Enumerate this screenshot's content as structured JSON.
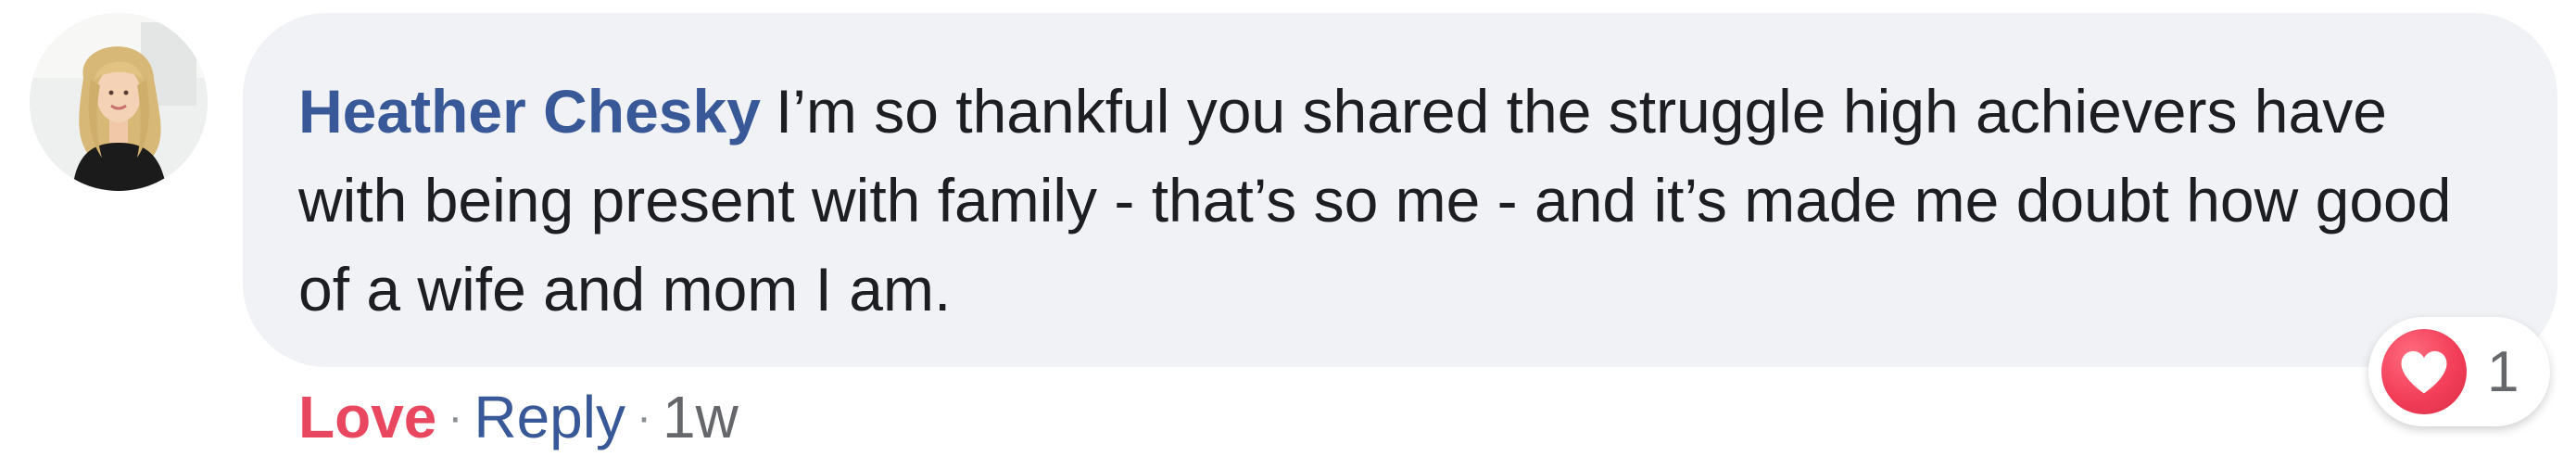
{
  "comment": {
    "author": "Heather Chesky",
    "text": "I’m so thankful you shared the struggle high achievers have with being present with family - that’s so me - and it’s made me doubt how good of a wife and mom I am."
  },
  "actions": {
    "love_label": "Love",
    "separator": "·",
    "reply_label": "Reply",
    "timestamp": "1w"
  },
  "reactions": {
    "icon": "heart-icon",
    "count": "1"
  },
  "colors": {
    "author": "#385898",
    "love": "#e8475f",
    "bubble": "#f0f2f5",
    "text": "#1c1e21",
    "reaction": "#f33e58"
  }
}
